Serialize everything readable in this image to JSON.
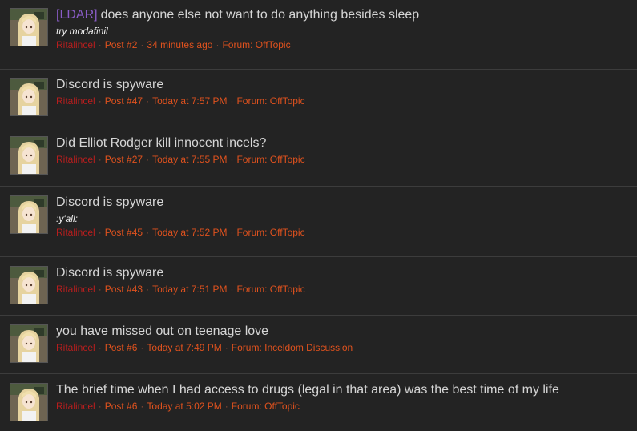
{
  "results": [
    {
      "prefix": "[LDAR]",
      "title": "does anyone else not want to do anything besides sleep",
      "snippet": "try modafinil",
      "user": "Ritalincel",
      "post": "Post #2",
      "time": "34 minutes ago",
      "forum": "Forum: OffTopic"
    },
    {
      "title": "Discord is spyware",
      "user": "Ritalincel",
      "post": "Post #47",
      "time": "Today at 7:57 PM",
      "forum": "Forum: OffTopic"
    },
    {
      "title": "Did Elliot Rodger kill innocent incels?",
      "user": "Ritalincel",
      "post": "Post #27",
      "time": "Today at 7:55 PM",
      "forum": "Forum: OffTopic"
    },
    {
      "title": "Discord is spyware",
      "snippet": ":y'all:",
      "user": "Ritalincel",
      "post": "Post #45",
      "time": "Today at 7:52 PM",
      "forum": "Forum: OffTopic"
    },
    {
      "title": "Discord is spyware",
      "user": "Ritalincel",
      "post": "Post #43",
      "time": "Today at 7:51 PM",
      "forum": "Forum: OffTopic"
    },
    {
      "title": "you have missed out on teenage love",
      "user": "Ritalincel",
      "post": "Post #6",
      "time": "Today at 7:49 PM",
      "forum": "Forum: Inceldom Discussion"
    },
    {
      "title": "The brief time when I had access to drugs (legal in that area) was the best time of my life",
      "user": "Ritalincel",
      "post": "Post #6",
      "time": "Today at 5:02 PM",
      "forum": "Forum: OffTopic"
    }
  ],
  "colors": {
    "background": "#232323",
    "title": "#d6d6d6",
    "prefix": "#8a5cc7",
    "username": "#b81e1e",
    "meta": "#e0521e"
  },
  "avatar_icon": "anime-avatar-icon"
}
